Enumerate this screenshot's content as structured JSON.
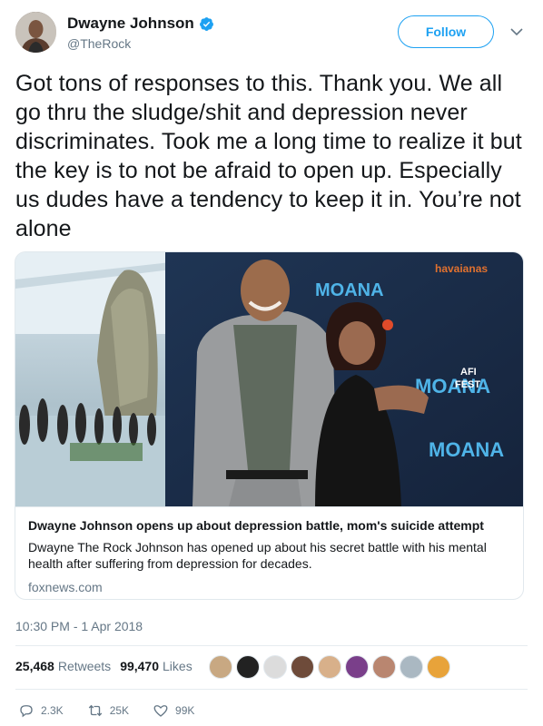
{
  "header": {
    "name": "Dwayne Johnson",
    "handle": "@TheRock",
    "follow_label": "Follow"
  },
  "tweet": {
    "text": "Got tons of responses to this. Thank you. We all go thru the sludge/shit and depression never discriminates. Took me a long time to realize it but the key is to not be afraid to open up. Especially us dudes have a tendency to keep it in. You’re not alone",
    "timestamp": "10:30 PM - 1 Apr 2018"
  },
  "card": {
    "title": "Dwayne Johnson opens up about depression battle, mom's suicide attempt",
    "description": "Dwayne The Rock Johnson has opened up about his secret battle with his mental health after suffering from depression for decades.",
    "domain": "foxnews.com",
    "backdrop": {
      "moana_1": "MOANA",
      "moana_2": "MOANA",
      "moana_3": "MOANA",
      "sponsor": "havaianas",
      "fest_1": "AFI",
      "fest_2": "FEST"
    }
  },
  "stats": {
    "retweets_count": "25,468",
    "retweets_label": "Retweets",
    "likes_count": "99,470",
    "likes_label": "Likes"
  },
  "actions": {
    "reply_count": "2.3K",
    "retweet_count": "25K",
    "like_count": "99K"
  },
  "colors": {
    "accent": "#1da1f2",
    "text": "#14171a",
    "secondary": "#657786",
    "border": "#e1e8ed"
  },
  "icons": [
    "verified-badge-icon",
    "chevron-down-icon",
    "reply-icon",
    "retweet-icon",
    "heart-icon"
  ]
}
